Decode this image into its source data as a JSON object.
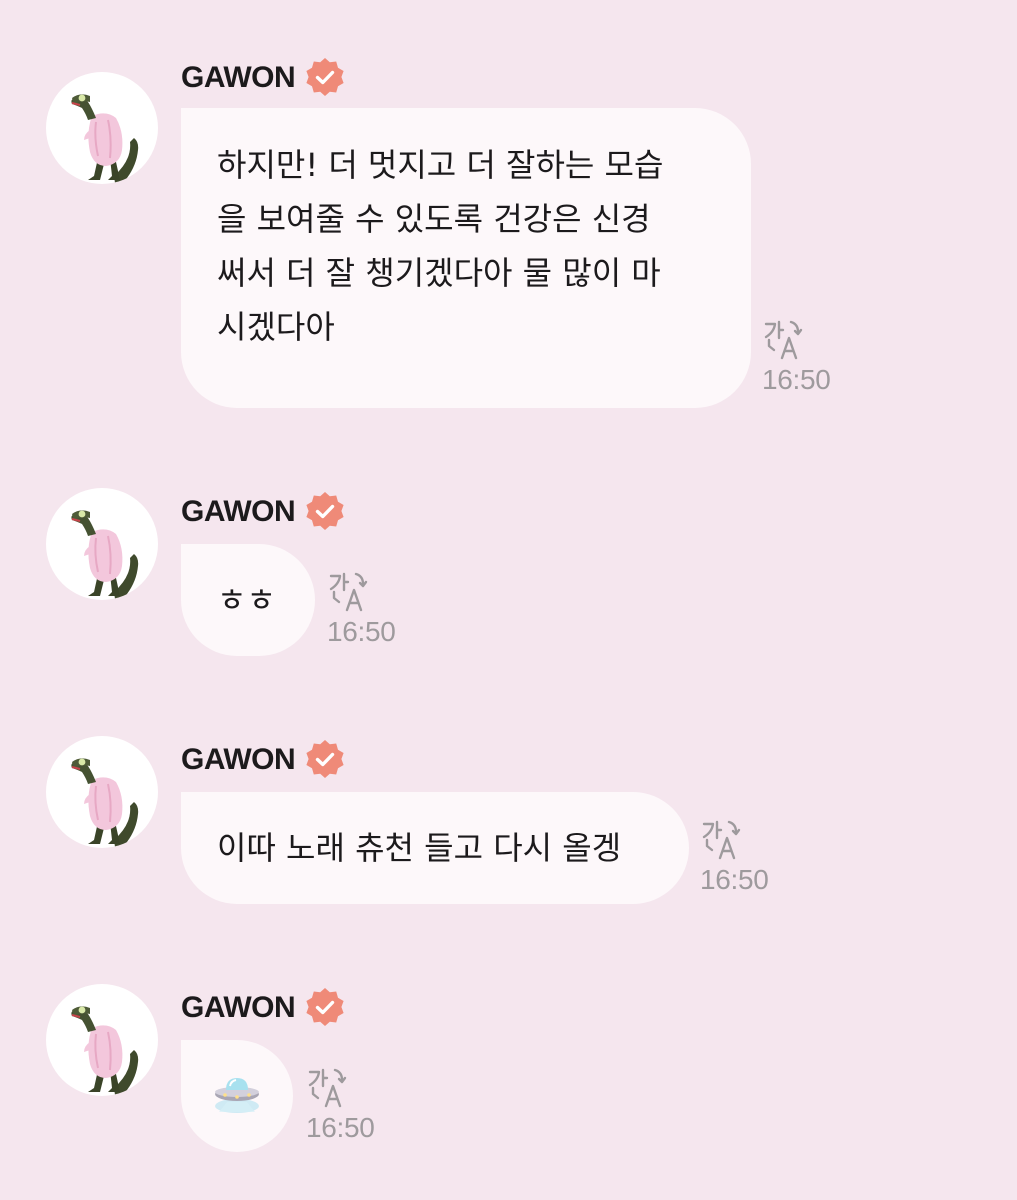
{
  "colors": {
    "background": "#f5e6ee",
    "bubble": "#fdf8fa",
    "verified_badge": "#ef8a78",
    "timestamp": "#9e9a9d"
  },
  "messages": [
    {
      "sender": "GAWON",
      "lines": [
        "하지만! 더 멋지고 더 잘하는 모습",
        "을 보여줄 수 있도록 건강은 신경",
        "써서 더 잘 챙기겠다아 물 많이 마",
        "시겠다아"
      ],
      "time": "16:50",
      "translate_icon": "translate-icon"
    },
    {
      "sender": "GAWON",
      "lines": [
        "ㅎㅎ"
      ],
      "time": "16:50",
      "translate_icon": "translate-icon"
    },
    {
      "sender": "GAWON",
      "lines": [
        "이따 노래 츄천 들고 다시 올겡"
      ],
      "time": "16:50",
      "translate_icon": "translate-icon"
    },
    {
      "sender": "GAWON",
      "emoji": "ufo-emoji",
      "time": "16:50",
      "translate_icon": "translate-icon"
    }
  ]
}
